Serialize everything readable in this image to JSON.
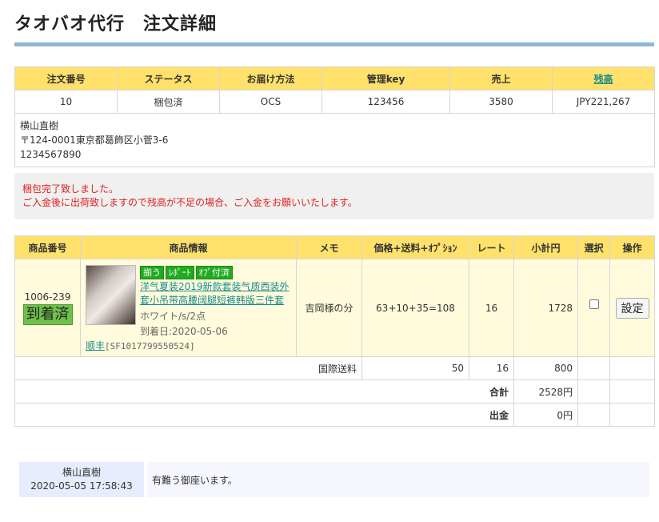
{
  "page": {
    "title": "タオバオ代行　注文詳細"
  },
  "summary": {
    "headers": [
      "注文番号",
      "ステータス",
      "お届け方法",
      "管理key",
      "売上",
      "残高"
    ],
    "values": [
      "10",
      "梱包済",
      "OCS",
      "123456",
      "3580",
      "JPY221,267"
    ],
    "address": {
      "name": "横山直樹",
      "postal_address": "〒124-0001東京都葛飾区小菅3-6",
      "phone": "1234567890"
    }
  },
  "notice": {
    "line1": "梱包完了致しました。",
    "line2": "ご入金後に出荷致しますので残高が不足の場合、ご入金をお願いいたします。"
  },
  "items": {
    "headers": [
      "商品番号",
      "商品情報",
      "メモ",
      "価格+送料+ｵﾌﾟｼｮﾝ",
      "レート",
      "小計円",
      "選択",
      "操作"
    ],
    "rows": [
      {
        "product_no": "1006-239",
        "status_badge": "到着済",
        "tags": [
          "揃う",
          "ﾚﾎﾟｰﾄ",
          "ｵﾌﾟ付済"
        ],
        "name": "洋气夏装2019新款套装气质西装外套小吊带高腰阔腿短裤韩版三件套",
        "spec": "ホワイト/s/2点",
        "arrival": "到着日:2020-05-06",
        "courier": "顺丰",
        "tracking": "[SF1017799550524]",
        "memo": "吉岡様の分",
        "price": "63+10+35=108",
        "rate": "16",
        "subtotal": "1728",
        "action_label": "設定"
      }
    ],
    "shipping": {
      "label": "国際送料",
      "price": "50",
      "rate": "16",
      "subtotal": "800"
    },
    "total": {
      "label": "合計",
      "value": "2528円"
    },
    "payout": {
      "label": "出金",
      "value": "0円"
    }
  },
  "message": {
    "author": "横山直樹",
    "timestamp": "2020-05-05 17:58:43",
    "text": "有難う御座います。"
  }
}
